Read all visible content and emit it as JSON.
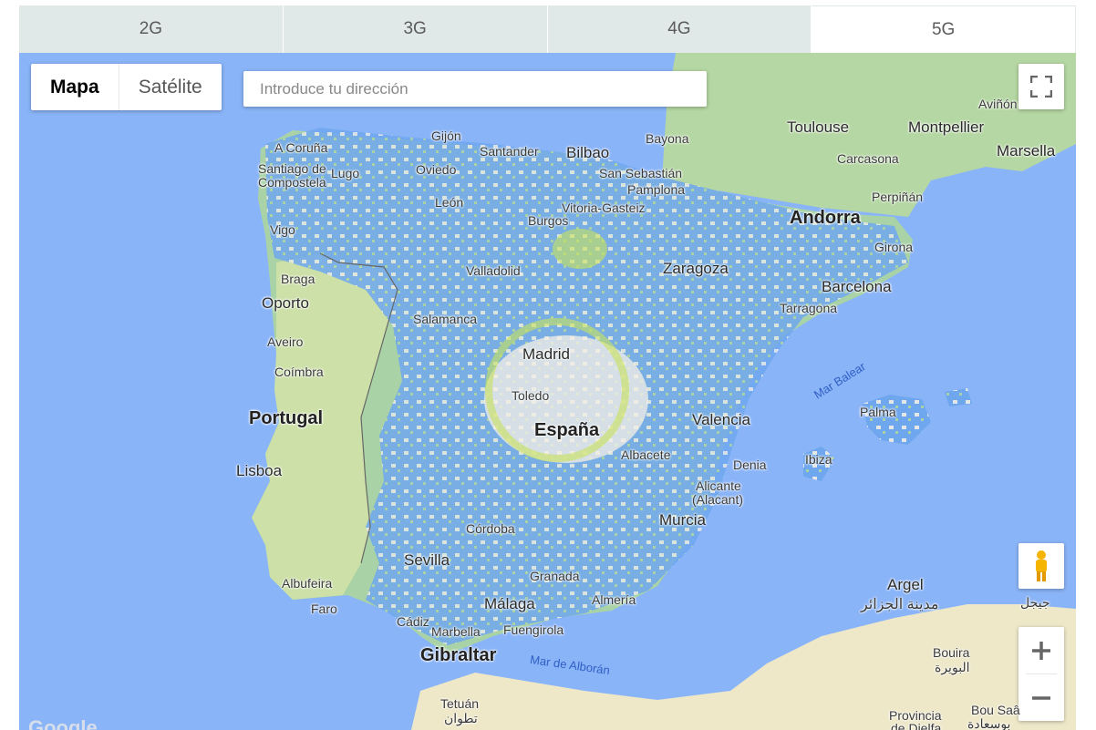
{
  "tabs": [
    {
      "label": "2G",
      "active": false
    },
    {
      "label": "3G",
      "active": false
    },
    {
      "label": "4G",
      "active": false
    },
    {
      "label": "5G",
      "active": true
    }
  ],
  "map_type": {
    "map_label": "Mapa",
    "satellite_label": "Satélite",
    "selected": "Mapa"
  },
  "search": {
    "placeholder": "Introduce tu dirección"
  },
  "controls": {
    "fullscreen_icon": "fullscreen-icon",
    "pegman_icon": "pegman-icon",
    "zoom_in": "+",
    "zoom_out": "−"
  },
  "colors": {
    "sea": "#8ab4f8",
    "land": "#a9d3a6",
    "coverage": "#5a9cf0",
    "urban": "#f4efe6",
    "highlight": "#c9e35a"
  },
  "labels": {
    "avinon": "Aviñón",
    "toulouse": "Toulouse",
    "montpellier": "Montpellier",
    "marsella": "Marsella",
    "carcasona": "Carcasona",
    "perpinan": "Perpiñán",
    "andorra": "Andorra",
    "girona": "Girona",
    "barcelona": "Barcelona",
    "tarragona": "Tarragona",
    "bayona": "Bayona",
    "bilbao": "Bilbao",
    "san_sebastian": "San Sebastián",
    "pamplona": "Pamplona",
    "vitoria": "Vitoria-Gasteiz",
    "santander": "Santander",
    "gijon": "Gijón",
    "oviedo": "Oviedo",
    "acoruna": "A Coruña",
    "santiago": "Santiago de Compostela",
    "lugo": "Lugo",
    "leon": "León",
    "vigo": "Vigo",
    "burgos": "Burgos",
    "braga": "Braga",
    "oporto": "Oporto",
    "valladolid": "Valladolid",
    "zaragoza": "Zaragoza",
    "salamanca": "Salamanca",
    "aveiro": "Aveiro",
    "coimbra": "Coímbra",
    "madrid": "Madrid",
    "toledo": "Toledo",
    "espana": "España",
    "portugal": "Portugal",
    "valencia": "Valencia",
    "mar_balear": "Mar Balear",
    "palma": "Palma",
    "ibiza": "Ibiza",
    "albacete": "Albacete",
    "denia": "Denia",
    "alicante": "Alicante",
    "alicante2": "(Alacant)",
    "lisboa": "Lisboa",
    "murcia": "Murcia",
    "cordoba": "Córdoba",
    "sevilla": "Sevilla",
    "granada": "Granada",
    "albufeira": "Albufeira",
    "faro": "Faro",
    "malaga": "Málaga",
    "almeria": "Almería",
    "argel": "Argel",
    "argel_ar": "مدينة الجزائر",
    "jijel_ar": "جيجل",
    "cadiz": "Cádiz",
    "marbella": "Marbella",
    "fuengirola": "Fuengirola",
    "gibraltar": "Gibraltar",
    "mar_alboran": "Mar de Alborán",
    "bouira": "Bouira",
    "bouira_ar": "البويرة",
    "tetuan": "Tetuán",
    "tetuan_ar": "تطوان",
    "provincia": "Provincia",
    "djelfa": "de Djelfa",
    "bousaada": "Bou Saâ",
    "bousaada_ar": "بوسعادة",
    "google": "Google"
  }
}
